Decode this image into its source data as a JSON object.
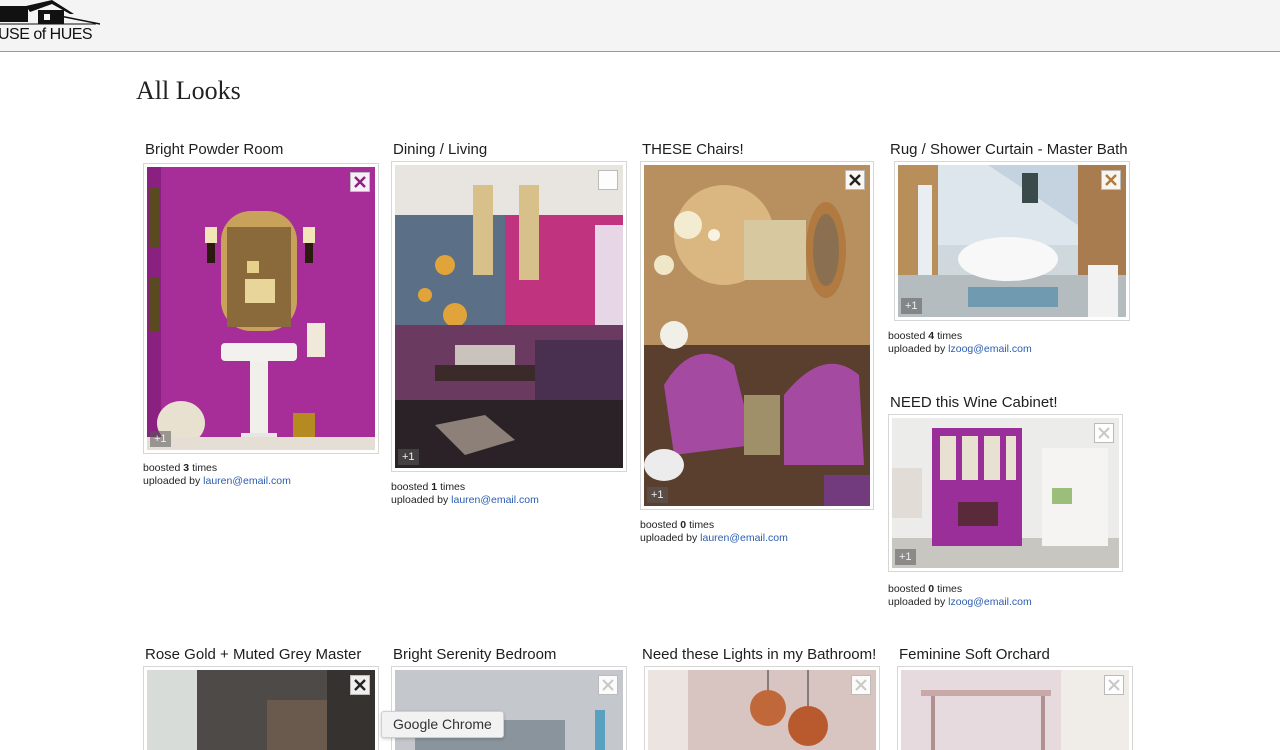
{
  "header": {
    "logo_text": "USE of HUES"
  },
  "page_title": "All Looks",
  "looks": [
    {
      "title": "Bright Powder Room",
      "boosted_prefix": "boosted",
      "boost_count": "3",
      "boosted_suffix": "times",
      "uploaded_prefix": "uploaded by",
      "uploader": "lauren@email.com",
      "plus_label": "+1"
    },
    {
      "title": "Dining / Living",
      "boosted_prefix": "boosted",
      "boost_count": "1",
      "boosted_suffix": "times",
      "uploaded_prefix": "uploaded by",
      "uploader": "lauren@email.com",
      "plus_label": "+1"
    },
    {
      "title": "THESE Chairs!",
      "boosted_prefix": "boosted",
      "boost_count": "0",
      "boosted_suffix": "times",
      "uploaded_prefix": "uploaded by",
      "uploader": "lauren@email.com",
      "plus_label": "+1"
    },
    {
      "title": "Rug / Shower Curtain - Master Bath",
      "boosted_prefix": "boosted",
      "boost_count": "4",
      "boosted_suffix": "times",
      "uploaded_prefix": "uploaded by",
      "uploader": "lzoog@email.com",
      "plus_label": "+1"
    },
    {
      "title": "NEED this Wine Cabinet!",
      "boosted_prefix": "boosted",
      "boost_count": "0",
      "boosted_suffix": "times",
      "uploaded_prefix": "uploaded by",
      "uploader": "lzoog@email.com",
      "plus_label": "+1"
    },
    {
      "title": "Rose Gold + Muted Grey Master"
    },
    {
      "title": "Bright Serenity Bedroom"
    },
    {
      "title": "Need these Lights in my Bathroom!"
    },
    {
      "title": "Feminine Soft Orchard"
    }
  ],
  "tooltip": "Google Chrome",
  "colors": {
    "link": "#2a5db0",
    "header_bg": "#f4f4f4",
    "accent_magenta": "#a8269a",
    "close_icon_orange": "#b07a3a"
  }
}
